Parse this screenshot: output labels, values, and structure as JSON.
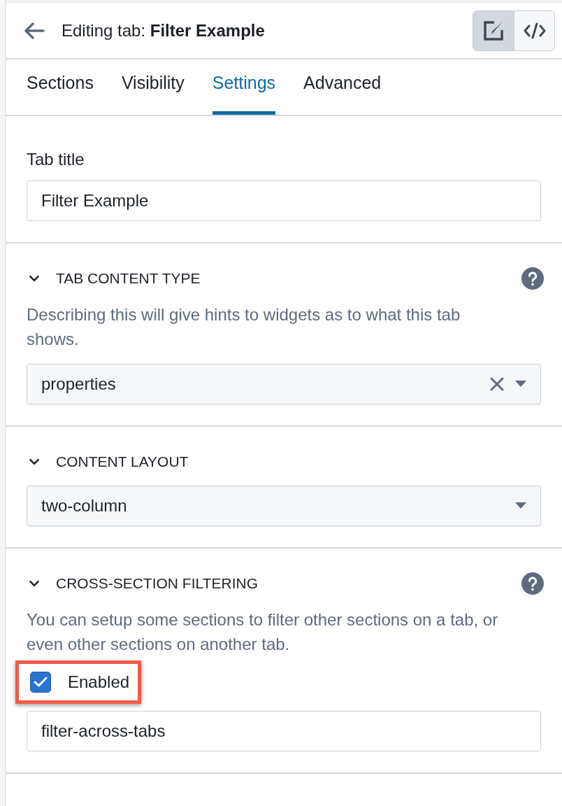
{
  "header": {
    "title": "Editing tab: **Filter Example**",
    "view_toggle": [
      {
        "kind": "design",
        "selected": true
      },
      {
        "kind": "code",
        "selected": false
      }
    ]
  },
  "tabs": [
    {
      "label": "Sections",
      "selected": false
    },
    {
      "label": "Visibility",
      "selected": false
    },
    {
      "label": "Settings",
      "selected": true
    },
    {
      "label": "Advanced",
      "selected": false
    }
  ],
  "sections": [
    {
      "kind": "field",
      "label": "Tab title",
      "value": "Filter Example"
    },
    {
      "kind": "group",
      "heading": "TAB CONTENT TYPE",
      "expanded": true,
      "help": true,
      "description": "Describing this will give hints to widgets as to what this tab shows.",
      "select": {
        "value": "properties",
        "clearable": true
      }
    },
    {
      "kind": "group",
      "heading": "CONTENT LAYOUT",
      "expanded": true,
      "help": false,
      "select": {
        "value": "two-column",
        "clearable": false
      }
    },
    {
      "kind": "group",
      "heading": "CROSS-SECTION FILTERING",
      "expanded": true,
      "help": true,
      "description": "You can setup some sections to filter other sections on a tab, or even other sections on another tab.",
      "checkbox": {
        "label": "Enabled",
        "checked": true,
        "highlighted": true
      },
      "field": {
        "value": "filter-across-tabs"
      }
    }
  ]
}
